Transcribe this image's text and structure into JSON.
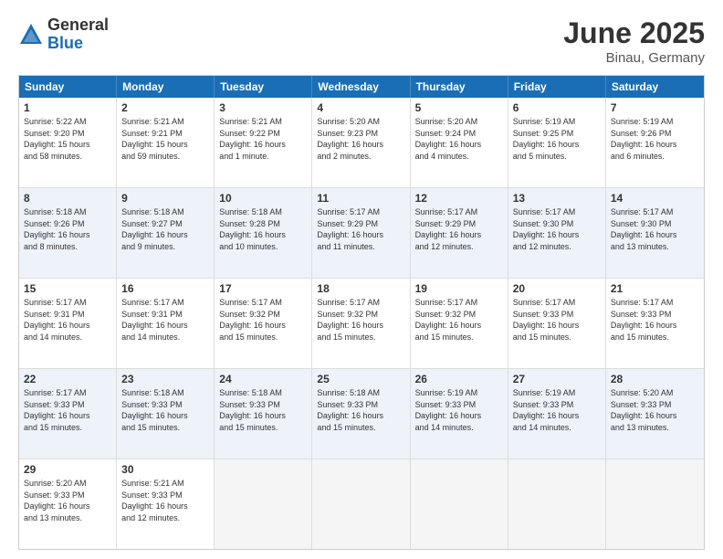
{
  "logo": {
    "general": "General",
    "blue": "Blue"
  },
  "title": "June 2025",
  "subtitle": "Binau, Germany",
  "days": [
    "Sunday",
    "Monday",
    "Tuesday",
    "Wednesday",
    "Thursday",
    "Friday",
    "Saturday"
  ],
  "rows": [
    [
      {
        "day": "1",
        "lines": [
          "Sunrise: 5:22 AM",
          "Sunset: 9:20 PM",
          "Daylight: 15 hours",
          "and 58 minutes."
        ]
      },
      {
        "day": "2",
        "lines": [
          "Sunrise: 5:21 AM",
          "Sunset: 9:21 PM",
          "Daylight: 15 hours",
          "and 59 minutes."
        ]
      },
      {
        "day": "3",
        "lines": [
          "Sunrise: 5:21 AM",
          "Sunset: 9:22 PM",
          "Daylight: 16 hours",
          "and 1 minute."
        ]
      },
      {
        "day": "4",
        "lines": [
          "Sunrise: 5:20 AM",
          "Sunset: 9:23 PM",
          "Daylight: 16 hours",
          "and 2 minutes."
        ]
      },
      {
        "day": "5",
        "lines": [
          "Sunrise: 5:20 AM",
          "Sunset: 9:24 PM",
          "Daylight: 16 hours",
          "and 4 minutes."
        ]
      },
      {
        "day": "6",
        "lines": [
          "Sunrise: 5:19 AM",
          "Sunset: 9:25 PM",
          "Daylight: 16 hours",
          "and 5 minutes."
        ]
      },
      {
        "day": "7",
        "lines": [
          "Sunrise: 5:19 AM",
          "Sunset: 9:26 PM",
          "Daylight: 16 hours",
          "and 6 minutes."
        ]
      }
    ],
    [
      {
        "day": "8",
        "lines": [
          "Sunrise: 5:18 AM",
          "Sunset: 9:26 PM",
          "Daylight: 16 hours",
          "and 8 minutes."
        ]
      },
      {
        "day": "9",
        "lines": [
          "Sunrise: 5:18 AM",
          "Sunset: 9:27 PM",
          "Daylight: 16 hours",
          "and 9 minutes."
        ]
      },
      {
        "day": "10",
        "lines": [
          "Sunrise: 5:18 AM",
          "Sunset: 9:28 PM",
          "Daylight: 16 hours",
          "and 10 minutes."
        ]
      },
      {
        "day": "11",
        "lines": [
          "Sunrise: 5:17 AM",
          "Sunset: 9:29 PM",
          "Daylight: 16 hours",
          "and 11 minutes."
        ]
      },
      {
        "day": "12",
        "lines": [
          "Sunrise: 5:17 AM",
          "Sunset: 9:29 PM",
          "Daylight: 16 hours",
          "and 12 minutes."
        ]
      },
      {
        "day": "13",
        "lines": [
          "Sunrise: 5:17 AM",
          "Sunset: 9:30 PM",
          "Daylight: 16 hours",
          "and 12 minutes."
        ]
      },
      {
        "day": "14",
        "lines": [
          "Sunrise: 5:17 AM",
          "Sunset: 9:30 PM",
          "Daylight: 16 hours",
          "and 13 minutes."
        ]
      }
    ],
    [
      {
        "day": "15",
        "lines": [
          "Sunrise: 5:17 AM",
          "Sunset: 9:31 PM",
          "Daylight: 16 hours",
          "and 14 minutes."
        ]
      },
      {
        "day": "16",
        "lines": [
          "Sunrise: 5:17 AM",
          "Sunset: 9:31 PM",
          "Daylight: 16 hours",
          "and 14 minutes."
        ]
      },
      {
        "day": "17",
        "lines": [
          "Sunrise: 5:17 AM",
          "Sunset: 9:32 PM",
          "Daylight: 16 hours",
          "and 15 minutes."
        ]
      },
      {
        "day": "18",
        "lines": [
          "Sunrise: 5:17 AM",
          "Sunset: 9:32 PM",
          "Daylight: 16 hours",
          "and 15 minutes."
        ]
      },
      {
        "day": "19",
        "lines": [
          "Sunrise: 5:17 AM",
          "Sunset: 9:32 PM",
          "Daylight: 16 hours",
          "and 15 minutes."
        ]
      },
      {
        "day": "20",
        "lines": [
          "Sunrise: 5:17 AM",
          "Sunset: 9:33 PM",
          "Daylight: 16 hours",
          "and 15 minutes."
        ]
      },
      {
        "day": "21",
        "lines": [
          "Sunrise: 5:17 AM",
          "Sunset: 9:33 PM",
          "Daylight: 16 hours",
          "and 15 minutes."
        ]
      }
    ],
    [
      {
        "day": "22",
        "lines": [
          "Sunrise: 5:17 AM",
          "Sunset: 9:33 PM",
          "Daylight: 16 hours",
          "and 15 minutes."
        ]
      },
      {
        "day": "23",
        "lines": [
          "Sunrise: 5:18 AM",
          "Sunset: 9:33 PM",
          "Daylight: 16 hours",
          "and 15 minutes."
        ]
      },
      {
        "day": "24",
        "lines": [
          "Sunrise: 5:18 AM",
          "Sunset: 9:33 PM",
          "Daylight: 16 hours",
          "and 15 minutes."
        ]
      },
      {
        "day": "25",
        "lines": [
          "Sunrise: 5:18 AM",
          "Sunset: 9:33 PM",
          "Daylight: 16 hours",
          "and 15 minutes."
        ]
      },
      {
        "day": "26",
        "lines": [
          "Sunrise: 5:19 AM",
          "Sunset: 9:33 PM",
          "Daylight: 16 hours",
          "and 14 minutes."
        ]
      },
      {
        "day": "27",
        "lines": [
          "Sunrise: 5:19 AM",
          "Sunset: 9:33 PM",
          "Daylight: 16 hours",
          "and 14 minutes."
        ]
      },
      {
        "day": "28",
        "lines": [
          "Sunrise: 5:20 AM",
          "Sunset: 9:33 PM",
          "Daylight: 16 hours",
          "and 13 minutes."
        ]
      }
    ],
    [
      {
        "day": "29",
        "lines": [
          "Sunrise: 5:20 AM",
          "Sunset: 9:33 PM",
          "Daylight: 16 hours",
          "and 13 minutes."
        ]
      },
      {
        "day": "30",
        "lines": [
          "Sunrise: 5:21 AM",
          "Sunset: 9:33 PM",
          "Daylight: 16 hours",
          "and 12 minutes."
        ]
      },
      {
        "day": "",
        "lines": []
      },
      {
        "day": "",
        "lines": []
      },
      {
        "day": "",
        "lines": []
      },
      {
        "day": "",
        "lines": []
      },
      {
        "day": "",
        "lines": []
      }
    ]
  ]
}
